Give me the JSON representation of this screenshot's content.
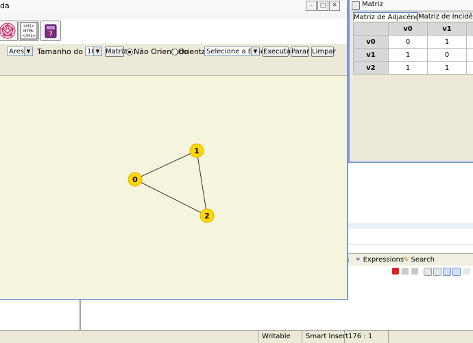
{
  "main_window": {
    "title_fragment": "da",
    "controls": {
      "element_type_value": "Aresta",
      "radius_label": "Tamanho do raio",
      "radius_value": "16",
      "matrix_button": "Matriz",
      "undirected_label": "Não Orientado",
      "directed_label": "Orientado",
      "search_select_value": "Selecione a Busca",
      "execute_button": "Executar",
      "stop_button": "Parar",
      "clear_button": "Limpar"
    },
    "toolbar_icons": [
      "pentagon-icon",
      "html-icon",
      "book-icon"
    ],
    "graph": {
      "vertices": [
        {
          "label": "0"
        },
        {
          "label": "1"
        },
        {
          "label": "2"
        }
      ],
      "edges": [
        [
          "0",
          "1"
        ],
        [
          "1",
          "2"
        ],
        [
          "0",
          "2"
        ]
      ]
    },
    "html_icon_text": "<H1>\nHTML\n</H1>"
  },
  "matrix_window": {
    "title": "Matriz",
    "tabs": [
      "Matriz de Adjacência",
      "Matriz de Incidência"
    ],
    "columns": [
      "v0",
      "v1"
    ],
    "rows": [
      {
        "label": "v0",
        "cells": [
          "0",
          "1"
        ]
      },
      {
        "label": "v1",
        "cells": [
          "1",
          "0"
        ]
      },
      {
        "label": "v2",
        "cells": [
          "1",
          "1"
        ]
      }
    ]
  },
  "ide": {
    "view_tabs": [
      "s",
      "Expressions",
      "Search"
    ],
    "status": [
      "Writable",
      "Smart Insert",
      "176 : 1"
    ]
  },
  "colors": {
    "canvas_bg": "#f5f5dd",
    "vertex_fill": "#ffd700",
    "window_border": "#7a96df"
  }
}
